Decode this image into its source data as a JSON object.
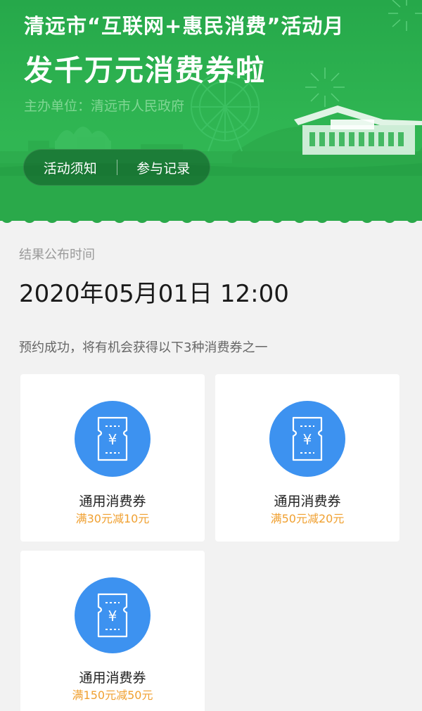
{
  "header": {
    "title_line1": "清远市“互联网+惠民消费”活动月",
    "title_line2": "发千万元消费券啦",
    "organizer_label": "主办单位：",
    "organizer_name": "清远市人民政府",
    "tabs": [
      {
        "label": "活动须知"
      },
      {
        "label": "参与记录"
      }
    ]
  },
  "result": {
    "label": "结果公布时间",
    "time": "2020年05月01日 12:00"
  },
  "notice": "预约成功，将有机会获得以下3种消费券之一",
  "coupons": [
    {
      "title": "通用消费券",
      "desc": "满30元减10元",
      "icon": "ticket-yuan-icon"
    },
    {
      "title": "通用消费券",
      "desc": "满50元减20元",
      "icon": "ticket-yuan-icon"
    },
    {
      "title": "通用消费券",
      "desc": "满150元减50元",
      "icon": "ticket-yuan-icon"
    }
  ],
  "colors": {
    "banner_green": "#2fb552",
    "coupon_blue": "#3d92f0",
    "discount_orange": "#f0a030"
  }
}
